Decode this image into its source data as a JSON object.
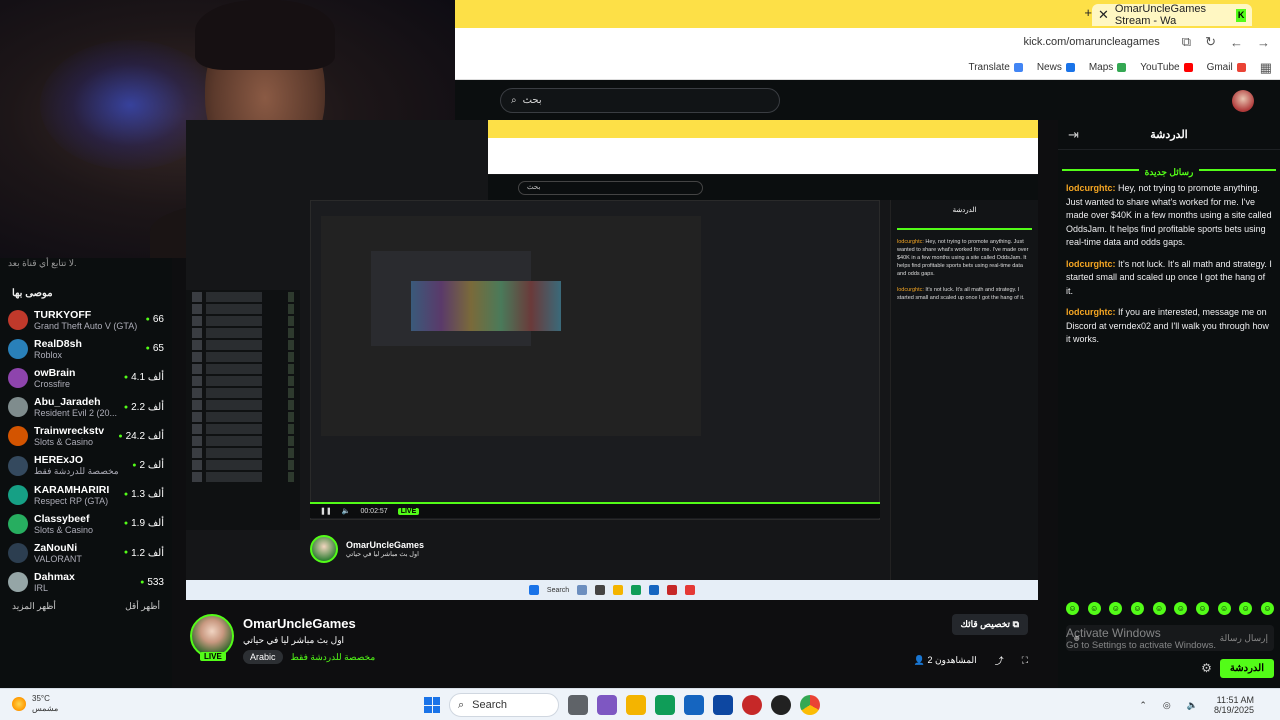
{
  "browser": {
    "tab_title": "OmarUncleGames Stream - Wa",
    "url": "kick.com/omaruncleagames",
    "bookmarks": [
      {
        "label": "Translate",
        "color": "#4285f4"
      },
      {
        "label": "News",
        "color": "#1a73e8"
      },
      {
        "label": "Maps",
        "color": "#34a853"
      },
      {
        "label": "YouTube",
        "color": "#ff0000"
      },
      {
        "label": "Gmail",
        "color": "#ea4335"
      }
    ]
  },
  "kick": {
    "search_placeholder": "بحث"
  },
  "sidebar": {
    "following_note": "لا تتابع أي قناة بعد.",
    "recommended_title": "موصى بها",
    "show_more": "أظهر المزيد",
    "show_less": "أظهر أقل",
    "items": [
      {
        "name": "TURKYOFF",
        "category": "Grand Theft Auto V (GTA)",
        "viewers": "66",
        "color": "#c0392b"
      },
      {
        "name": "RealD8sh",
        "category": "Roblox",
        "viewers": "65",
        "color": "#2980b9"
      },
      {
        "name": "owBrain",
        "category": "Crossfire",
        "viewers": "4.1 ألف",
        "color": "#8e44ad"
      },
      {
        "name": "Abu_Jaradeh",
        "category": "Resident Evil 2 (20...",
        "viewers": "2.2 ألف",
        "color": "#7f8c8d"
      },
      {
        "name": "Trainwreckstv",
        "category": "Slots & Casino",
        "viewers": "24.2 ألف",
        "color": "#d35400"
      },
      {
        "name": "HERExJO",
        "category": "مخصصة للدردشة فقط",
        "viewers": "2 ألف",
        "color": "#34495e"
      },
      {
        "name": "KARAMHARIRI",
        "category": "Respect RP (GTA)",
        "viewers": "1.3 ألف",
        "color": "#16a085"
      },
      {
        "name": "Classybeef",
        "category": "Slots & Casino",
        "viewers": "1.9 ألف",
        "color": "#27ae60"
      },
      {
        "name": "ZaNouNi",
        "category": "VALORANT",
        "viewers": "1.2 ألف",
        "color": "#2c3e50"
      },
      {
        "name": "Dahmax",
        "category": "IRL",
        "viewers": "533",
        "color": "#95a5a6"
      }
    ]
  },
  "player": {
    "time": "00:02:57",
    "live": "LIVE",
    "channel": "OmarUncleGames",
    "taskbar_search": "Search"
  },
  "chat": {
    "title": "الدردشة",
    "new_messages": "رسائل جديدة",
    "messages": [
      {
        "user": "lodcurghtc:",
        "text": " Hey, not trying to promote anything. Just wanted to share what's worked for me. I've made over $40K in a few months using a site called OddsJam. It helps find profitable sports bets using real-time data and odds gaps."
      },
      {
        "user": "lodcurghtc:",
        "text": " It's not luck. It's all math and strategy. I started small and scaled up once I got the hang of it."
      },
      {
        "user": "lodcurghtc:",
        "text": " If you are interested, message me on Discord at verndex02 and I'll walk you through how it works."
      }
    ],
    "input_placeholder": "إرسال رسالة",
    "send_label": "الدردشة"
  },
  "watermark": {
    "title": "Activate Windows",
    "subtitle": "Go to Settings to activate Windows."
  },
  "channel": {
    "name": "OmarUncleGames",
    "live": "LIVE",
    "stream_title": "اول بث مباشر ليا في حياتي",
    "category": "مخصصة للدردشة فقط",
    "language": "Arabic",
    "clip_label": "تخصيص قائك",
    "viewers": "المشاهدون 2"
  },
  "taskbar": {
    "temperature": "35°C",
    "weather_desc": "مشمس",
    "search": "Search",
    "time": "11:51 AM",
    "date": "8/19/2025"
  }
}
